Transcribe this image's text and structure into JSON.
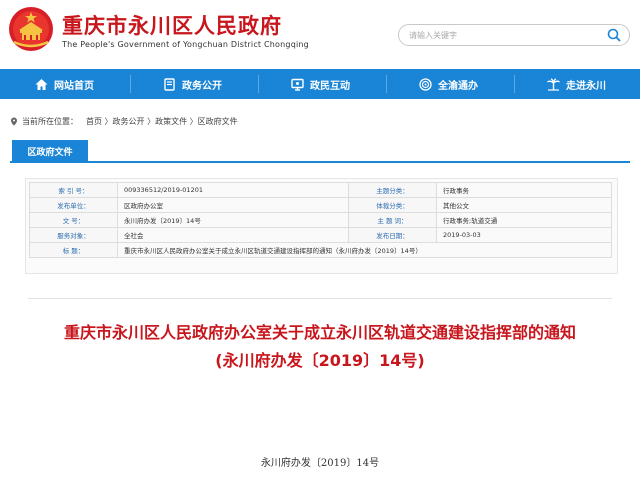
{
  "header": {
    "title": "重庆市永川区人民政府",
    "subtitle": "The People's Government of Yongchuan District Chongqing",
    "search_placeholder": "请输入关键字",
    "accent_color": "#c8161d"
  },
  "nav": {
    "color": "#1a85d6",
    "items": [
      {
        "label": "网站首页",
        "icon": "home-icon"
      },
      {
        "label": "政务公开",
        "icon": "book-icon"
      },
      {
        "label": "政民互动",
        "icon": "monitor-icon"
      },
      {
        "label": "全渝通办",
        "icon": "signal-icon"
      },
      {
        "label": "走进永川",
        "icon": "palm-icon"
      }
    ]
  },
  "breadcrumb": {
    "prefix": "当前所在位置：",
    "items": [
      "首页",
      "政务公开",
      "政策文件",
      "区政府文件"
    ]
  },
  "section_tab": "区政府文件",
  "info": {
    "rows": [
      {
        "l1": "索  引  号：",
        "v1": "009336512/2019-01201",
        "l2": "主题分类：",
        "v2": "行政事务"
      },
      {
        "l1": "发布单位：",
        "v1": "区政府办公室",
        "l2": "体裁分类：",
        "v2": "其他公文"
      },
      {
        "l1": "文      号：",
        "v1": "永川府办发〔2019〕14号",
        "l2": "主  题  词：",
        "v2": "行政事务;轨道交通"
      },
      {
        "l1": "服务对象：",
        "v1": "全社会",
        "l2": "发布日期：",
        "v2": "2019-03-03"
      }
    ],
    "title_label": "标      题：",
    "title_value": "重庆市永川区人民政府办公室关于成立永川区轨道交通建设指挥部的通知（永川府办发〔2019〕14号）"
  },
  "document": {
    "title_line1": "重庆市永川区人民政府办公室关于成立永川区轨道交通建设指挥部的通知",
    "title_line2": "(永川府办发〔2019〕14号)",
    "doc_number": "永川府办发〔2019〕14号"
  }
}
